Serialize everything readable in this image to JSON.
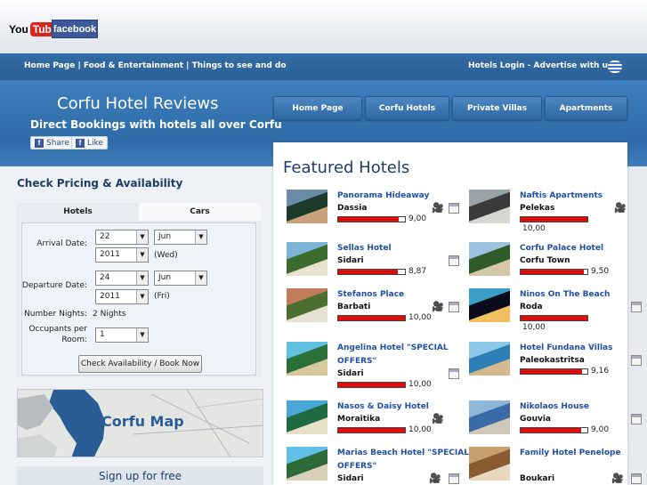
{
  "top": {
    "youtube_you": "You",
    "youtube_tube": "Tube",
    "facebook": "facebook"
  },
  "nav": {
    "left_links": "Home Page | Food & Entertainment | Things to see and do",
    "right_links": "Hotels Login - Advertise with us"
  },
  "hero": {
    "title": "Corfu Hotel Reviews",
    "subtitle": "Direct Bookings with hotels all over Corfu",
    "share": "Share",
    "like": "Like"
  },
  "tabs": [
    "Home Page",
    "Corfu Hotels",
    "Private Villas",
    "Apartments"
  ],
  "booking": {
    "title": "Check Pricing & Availability",
    "tab_hotels": "Hotels",
    "tab_cars": "Cars",
    "arrival_label": "Arrival Date:",
    "arrival_day": "22",
    "arrival_month": "Jun",
    "arrival_year": "2011",
    "arrival_weekday": "(Wed)",
    "departure_label": "Departure Date:",
    "departure_day": "24",
    "departure_month": "Jun",
    "departure_year": "2011",
    "departure_weekday": "(Fri)",
    "nights_label": "Number Nights:",
    "nights_value": "2 Nights",
    "occupants_label_1": "Occupants per",
    "occupants_label_2": "Room:",
    "occupants_value": "1",
    "button": "Check Availability / Book Now"
  },
  "map": {
    "label": "Corfu Map"
  },
  "signup": "Sign up for free",
  "featured": {
    "title": "Featured Hotels",
    "hotels": [
      {
        "name": "Panorama Hideaway",
        "location": "Dassia",
        "score": "9,00",
        "rating": 0.9
      },
      {
        "name": "Naftis Apartments",
        "location": "Pelekas",
        "score": "10,00",
        "rating": 1.0
      },
      {
        "name": "Sellas Hotel",
        "location": "Sidari",
        "score": "8,87",
        "rating": 0.887
      },
      {
        "name": "Corfu Palace Hotel",
        "location": "Corfu Town",
        "score": "9,50",
        "rating": 0.95
      },
      {
        "name": "Stefanos Place",
        "location": "Barbati",
        "score": "10,00",
        "rating": 1.0
      },
      {
        "name": "Ninos On The Beach",
        "location": "Roda",
        "score": "10,00",
        "rating": 1.0
      },
      {
        "name": "Angelina Hotel \"SPECIAL OFFERS\"",
        "location": "Sidari",
        "score": "10,00",
        "rating": 1.0
      },
      {
        "name": "Hotel Fundana Villas",
        "location": "Paleokastritsa",
        "score": "9,16",
        "rating": 0.916
      },
      {
        "name": "Nasos & Daisy Hotel",
        "location": "Moraitika",
        "score": "10,00",
        "rating": 1.0
      },
      {
        "name": "Nikolaos House",
        "location": "Gouvia",
        "score": "9,00",
        "rating": 0.9
      },
      {
        "name": "Marias Beach Hotel \"SPECIAL OFFERS\"",
        "location": "Sidari",
        "score": "",
        "rating": 0
      },
      {
        "name": "Family Hotel Penelope",
        "location": "Boukari",
        "score": "",
        "rating": 0
      }
    ]
  },
  "colors": {
    "accent": "#2f68a3",
    "rating_fill": "#e00c0c",
    "link": "#1f4fa5"
  }
}
